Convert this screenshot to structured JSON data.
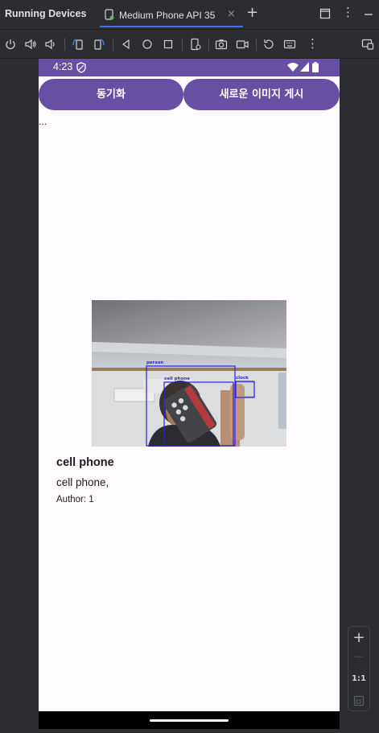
{
  "ide": {
    "title": "Running Devices",
    "tab_label": "Medium Phone API 35",
    "tab_close": "×",
    "add_tab": "+",
    "menu_dots": "⋮"
  },
  "toolbar": {
    "icons": [
      "power-icon",
      "volume-up-icon",
      "volume-down-icon",
      "rotate-left-icon",
      "rotate-right-icon",
      "back-icon",
      "home-icon",
      "overview-icon",
      "device-settings-icon",
      "screenshot-icon",
      "screen-record-icon",
      "reset-icon",
      "keyboard-icon",
      "more-icon",
      "device-frame-icon"
    ]
  },
  "phone": {
    "status_time": "4:23",
    "buttons": {
      "sync": "동기화",
      "new_post": "새로운 이미지 게시"
    },
    "ellipsis": "...",
    "detections": {
      "person": "person",
      "cell_phone": "cell phone",
      "clock": "clock"
    },
    "post": {
      "title": "cell phone",
      "text": "cell phone,",
      "author": "Author: 1"
    },
    "colors": {
      "primary": "#6750a4",
      "background": "#fffbfe",
      "detection_box": "#2a1fe0"
    }
  },
  "zoom": {
    "plus": "+",
    "minus": "—",
    "one_to_one": "1:1"
  }
}
